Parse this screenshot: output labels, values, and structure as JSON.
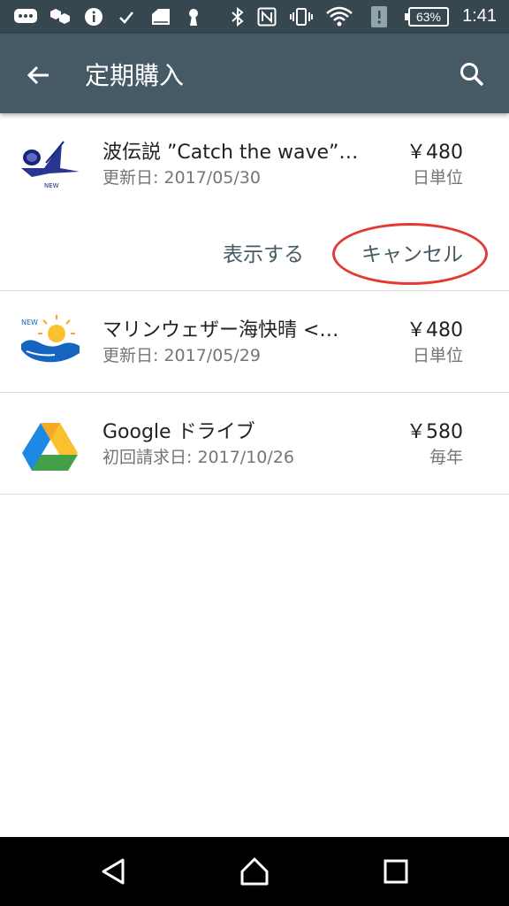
{
  "status_bar": {
    "time": "1:41",
    "battery": "63%",
    "icons": [
      "message-icon",
      "hexagons-icon",
      "info-icon",
      "check-icon",
      "sd-card-icon",
      "keyhole-icon",
      "bluetooth-icon",
      "nfc-icon",
      "vibrate-icon",
      "wifi-icon",
      "alert-icon"
    ]
  },
  "appbar": {
    "title": "定期購入",
    "back_icon": "arrow-back-icon",
    "search_icon": "search-icon"
  },
  "subscriptions": [
    {
      "name": "波伝説 ”Catch the wave”…",
      "date": "更新日: 2017/05/30",
      "price": "￥480",
      "period": "日単位",
      "icon": "wave-app-icon",
      "icon_text": "NEW",
      "expanded": true,
      "actions": {
        "show": "表示する",
        "cancel": "キャンセル"
      }
    },
    {
      "name": "マリンウェザー海快晴 <…",
      "date": "更新日: 2017/05/29",
      "price": "￥480",
      "period": "日単位",
      "icon": "marine-weather-icon",
      "icon_text": "NEW",
      "expanded": false
    },
    {
      "name": "Google ドライブ",
      "date": "初回請求日: 2017/10/26",
      "price": "￥580",
      "period": "毎年",
      "icon": "google-drive-icon",
      "expanded": false
    }
  ],
  "navbar": {
    "back": "nav-back-icon",
    "home": "nav-home-icon",
    "recents": "nav-recents-icon"
  },
  "colors": {
    "status_bar": "#37474f",
    "app_bar": "#455a64",
    "highlight_circle": "#e53935"
  }
}
